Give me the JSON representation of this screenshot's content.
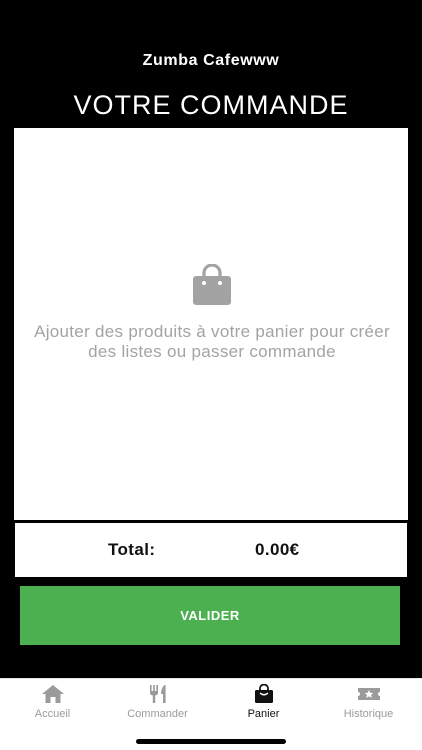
{
  "header": {
    "app_title": "Zumba Cafewww",
    "page_title": "VOTRE COMMANDE"
  },
  "cart": {
    "empty_icon": "shopping-bag-icon",
    "empty_message": "Ajouter des produits à votre panier pour créer des listes ou passer commande"
  },
  "total": {
    "label": "Total:",
    "value": "0.00€"
  },
  "actions": {
    "validate_label": "VALIDER",
    "validate_color": "#4caf50"
  },
  "tabbar": {
    "items": [
      {
        "label": "Accueil",
        "icon": "home-icon",
        "active": false
      },
      {
        "label": "Commander",
        "icon": "fork-knife-icon",
        "active": false
      },
      {
        "label": "Panier",
        "icon": "shopping-bag-icon",
        "active": true
      },
      {
        "label": "Historique",
        "icon": "ticket-star-icon",
        "active": false
      }
    ]
  },
  "colors": {
    "background": "#000000",
    "panel": "#ffffff",
    "muted_text": "#a3a3a3",
    "inactive_tab": "#9b9b9b"
  }
}
